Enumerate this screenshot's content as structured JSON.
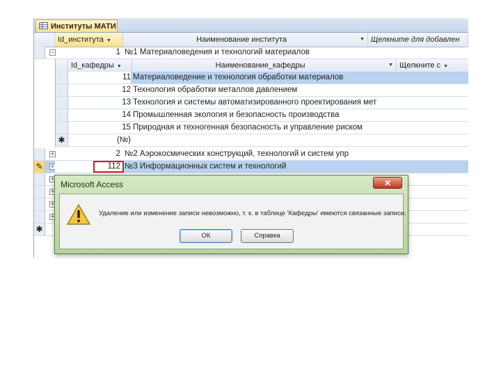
{
  "tab": {
    "title": "Институты МАТИ"
  },
  "outer": {
    "columns": [
      "Id_института",
      "Наименование института",
      "Щелкните для добавлен"
    ],
    "rows": [
      {
        "id": "1",
        "name": "№1 Материаловедения и технологий материалов",
        "expanded": true
      },
      {
        "id": "2",
        "name": "№2 Аэрокосмических конструкций, технологий и систем упр"
      },
      {
        "id": "112",
        "name": "№3 Информационных систем и технологий",
        "current": true
      },
      {
        "id": "",
        "name": ""
      },
      {
        "id": "",
        "name": ""
      },
      {
        "id": "",
        "name": ""
      },
      {
        "id": "",
        "name": ""
      }
    ]
  },
  "sub": {
    "columns": [
      "Id_кафедры",
      "Наименование_кафедры",
      "Щелкните с"
    ],
    "rows": [
      {
        "id": "11",
        "name": "Материаловедение и технология обработки материалов"
      },
      {
        "id": "12",
        "name": "Технология обработки металлов давлением"
      },
      {
        "id": "13",
        "name": "Технология и системы автоматизированного проектирования мет"
      },
      {
        "id": "14",
        "name": "Промышленная экология и безопасность производства"
      },
      {
        "id": "15",
        "name": "Природная и техногенная безопасность и управление риском"
      },
      {
        "id": "(№)",
        "name": ""
      }
    ]
  },
  "dialog": {
    "title": "Microsoft Access",
    "message": "Удаление или изменение записи невозможно, т. к. в таблице 'Кафедры' имеются связанные записи.",
    "ok_label": "ОК",
    "help_label": "Справка"
  },
  "icons": {
    "row_selector_edit": "pencil-icon",
    "new_record": "asterisk-icon",
    "expand": "plus-icon",
    "warning": "warning-icon"
  },
  "colors": {
    "selection": "#b8d2ef",
    "highlight_box": "#d81e1e"
  }
}
